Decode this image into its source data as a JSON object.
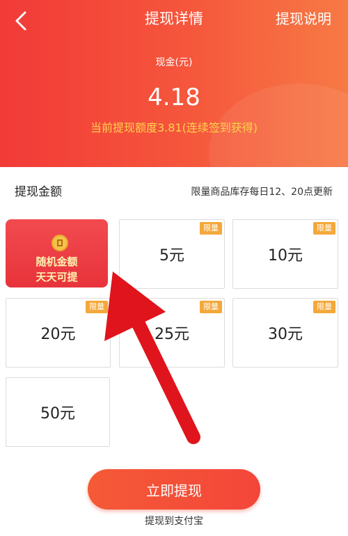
{
  "header": {
    "title": "提现详情",
    "help_label": "提现说明",
    "cash_label": "现金(元)",
    "cash_value": "4.18",
    "quota_text": "当前提现额度3.81(连续签到获得)"
  },
  "amount_section": {
    "title": "提现金额",
    "notice": "限量商品库存每日12、20点更新"
  },
  "options": [
    {
      "line1": "随机金额",
      "line2": "天天可提"
    },
    {
      "amount": "5元",
      "tag": "限量"
    },
    {
      "amount": "10元",
      "tag": "限量"
    },
    {
      "amount": "20元",
      "tag": "限量"
    },
    {
      "amount": "25元",
      "tag": "限量"
    },
    {
      "amount": "30元",
      "tag": "限量"
    },
    {
      "amount": "50元"
    }
  ],
  "submit_label": "立即提现",
  "footnote": "提现到支付宝",
  "colors": {
    "header_red": "#f23a37",
    "header_orange": "#f77a45",
    "quota_yellow": "#ffd24d",
    "tag_orange": "#f4a83a",
    "feature_red": "#e8333b",
    "arrow_red": "#e0141c"
  },
  "icons": [
    "back-arrow-icon",
    "coin-icon"
  ]
}
